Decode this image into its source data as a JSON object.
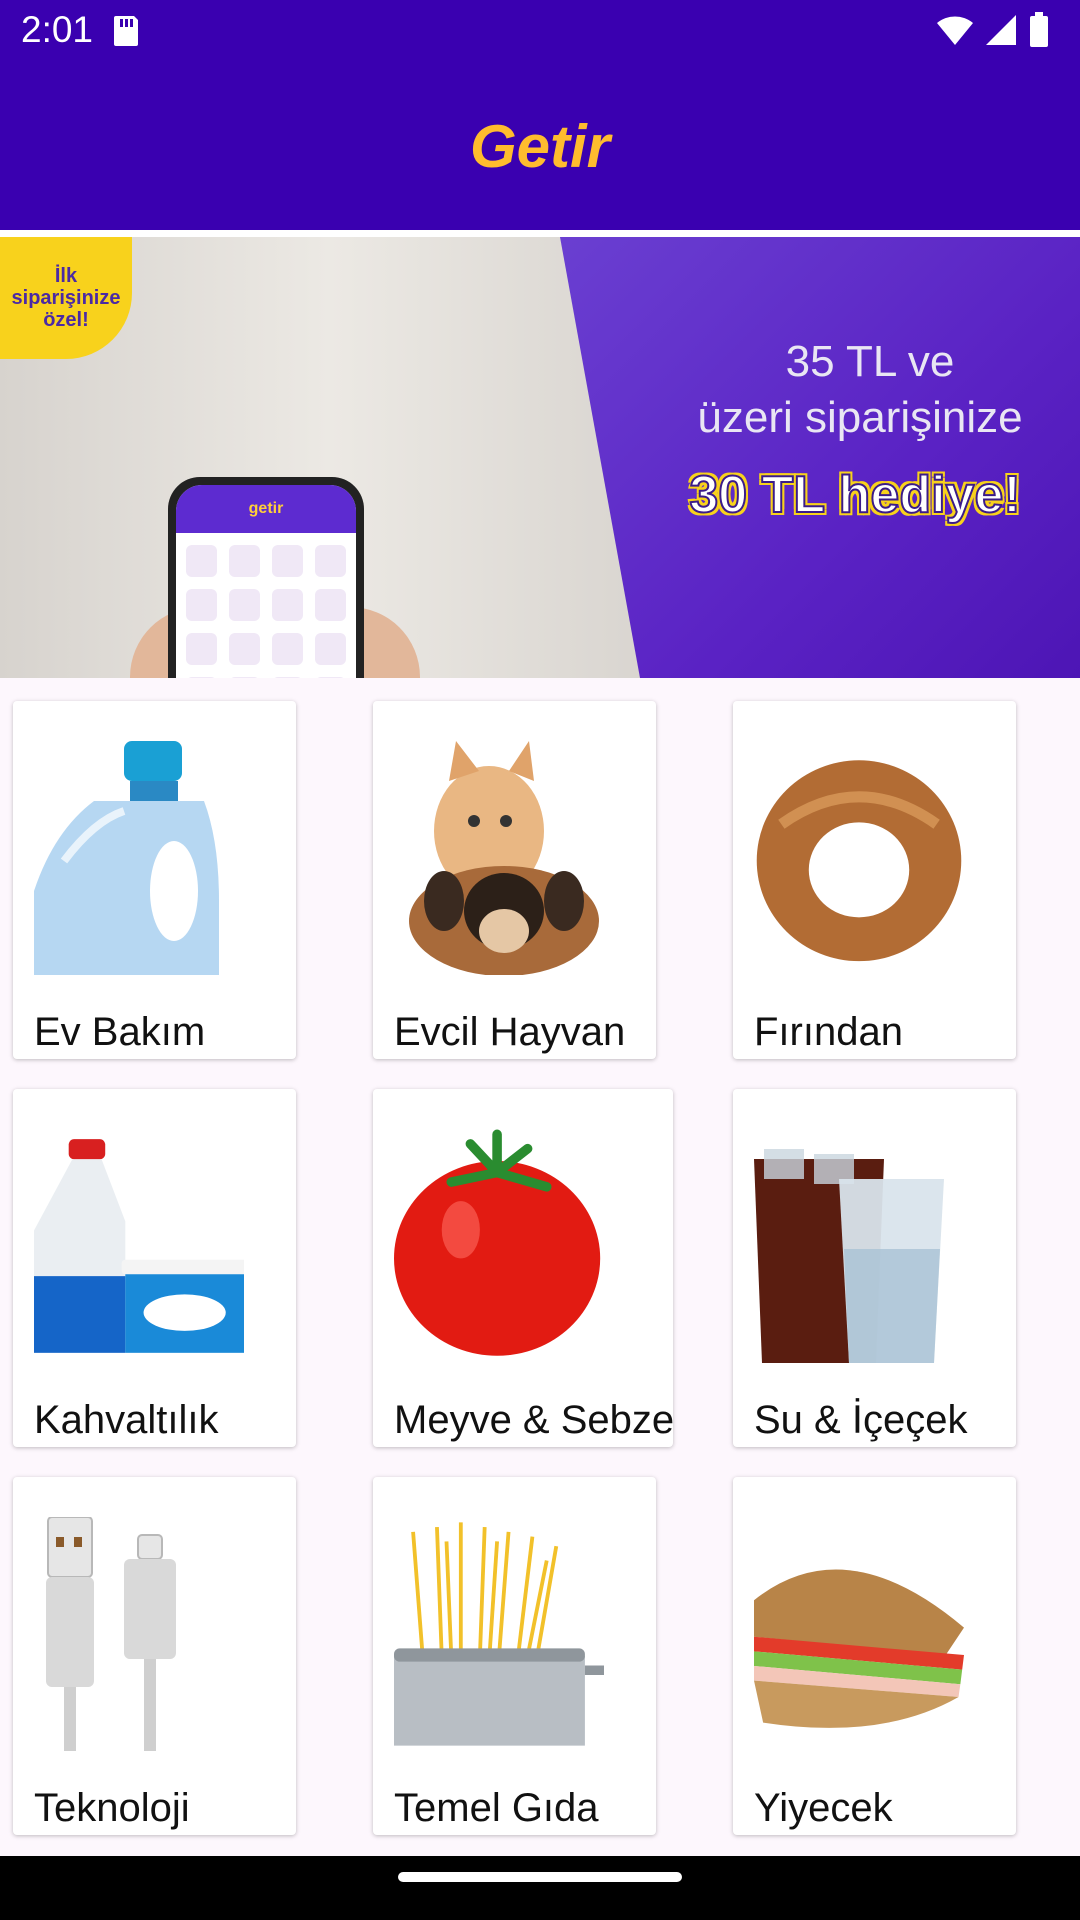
{
  "status": {
    "time": "2:01"
  },
  "app": {
    "title": "Getir"
  },
  "banner": {
    "badge": "İlk siparişinize özel!",
    "line1": "35 TL ve",
    "line2": "üzeri siparişinize",
    "highlight": "30 TL hediye!",
    "phone_brand": "getir"
  },
  "categories": [
    {
      "label": "Ev Bakım",
      "icon": "detergent-bottle-icon"
    },
    {
      "label": "Evcil Hayvan",
      "icon": "cat-dog-icon"
    },
    {
      "label": "Fırından",
      "icon": "simit-icon"
    },
    {
      "label": "Kahvaltılık",
      "icon": "milk-yogurt-icon"
    },
    {
      "label": "Meyve & Sebze",
      "icon": "tomato-icon"
    },
    {
      "label": "Su & İçeçek",
      "icon": "drinks-icon"
    },
    {
      "label": "Teknoloji",
      "icon": "usb-cable-icon"
    },
    {
      "label": "Temel Gıda",
      "icon": "pasta-pot-icon"
    },
    {
      "label": "Yiyecek",
      "icon": "sandwich-icon"
    }
  ],
  "colors": {
    "primary": "#3a00b0",
    "accent": "#ffbc2e",
    "banner_purple": "#5a22c4"
  }
}
